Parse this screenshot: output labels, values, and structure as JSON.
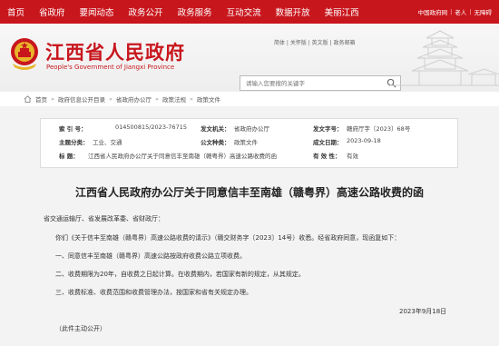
{
  "topnav": {
    "items": [
      "首页",
      "省政府",
      "要闻动态",
      "政务公开",
      "政务服务",
      "互动交流",
      "数据开放",
      "美丽江西"
    ],
    "right": [
      "中国政府网",
      "老人",
      "无障碍"
    ]
  },
  "header": {
    "title": "江西省人民政府",
    "title_en": "People's Government of Jiangxi Province",
    "toplinks": "简体 | 关怀版 | 英文版 | 政务邮箱",
    "search_placeholder": "请输入您要搜的关键字"
  },
  "breadcrumb": [
    "首页",
    "政府信息公开目录",
    "省政府办公厅",
    "政策法规",
    "政策文件"
  ],
  "meta": {
    "index_label": "索    引 号：",
    "index_value": "014500815/2023-76715",
    "issuer_label": "发文机关：",
    "issuer_value": "省政府办公厅",
    "docno_label": "发文字号：",
    "docno_value": "赣府厅字〔2023〕68号",
    "topic_label": "主题分类：",
    "topic_value": "工业、交通",
    "doctype_label": "公文种类：",
    "doctype_value": "政策文件",
    "date_label": "成文日期：",
    "date_value": "2023-09-18",
    "title_label": "标    题：",
    "title_value": "江西省人民政府办公厅关于同意信丰至南雄（赣粤界）高速公路收费的函",
    "validity_label": "有 效 性：",
    "validity_value": "有效"
  },
  "doc": {
    "title": "江西省人民政府办公厅关于同意信丰至南雄（赣粤界）高速公路收费的函",
    "recipient": "省交通运输厅、省发展改革委、省财政厅：",
    "intro": "你们《关于信丰至南雄（赣粤界）高速公路收费的请示》（赣交财务字〔2023〕14号）收悉。经省政府同意，现函复如下：",
    "item1": "一、同意信丰至南雄（赣粤界）高速公路按政府收费公路立项收费。",
    "item2": "二、收费期限为20年，自收费之日起计算。在收费期内，若国家有新的规定，从其规定。",
    "item3": "三、收费标准、收费范围和收费管理办法，按国家和省有关规定办理。",
    "date": "2023年9月18日",
    "note": "（此件主动公开）"
  }
}
